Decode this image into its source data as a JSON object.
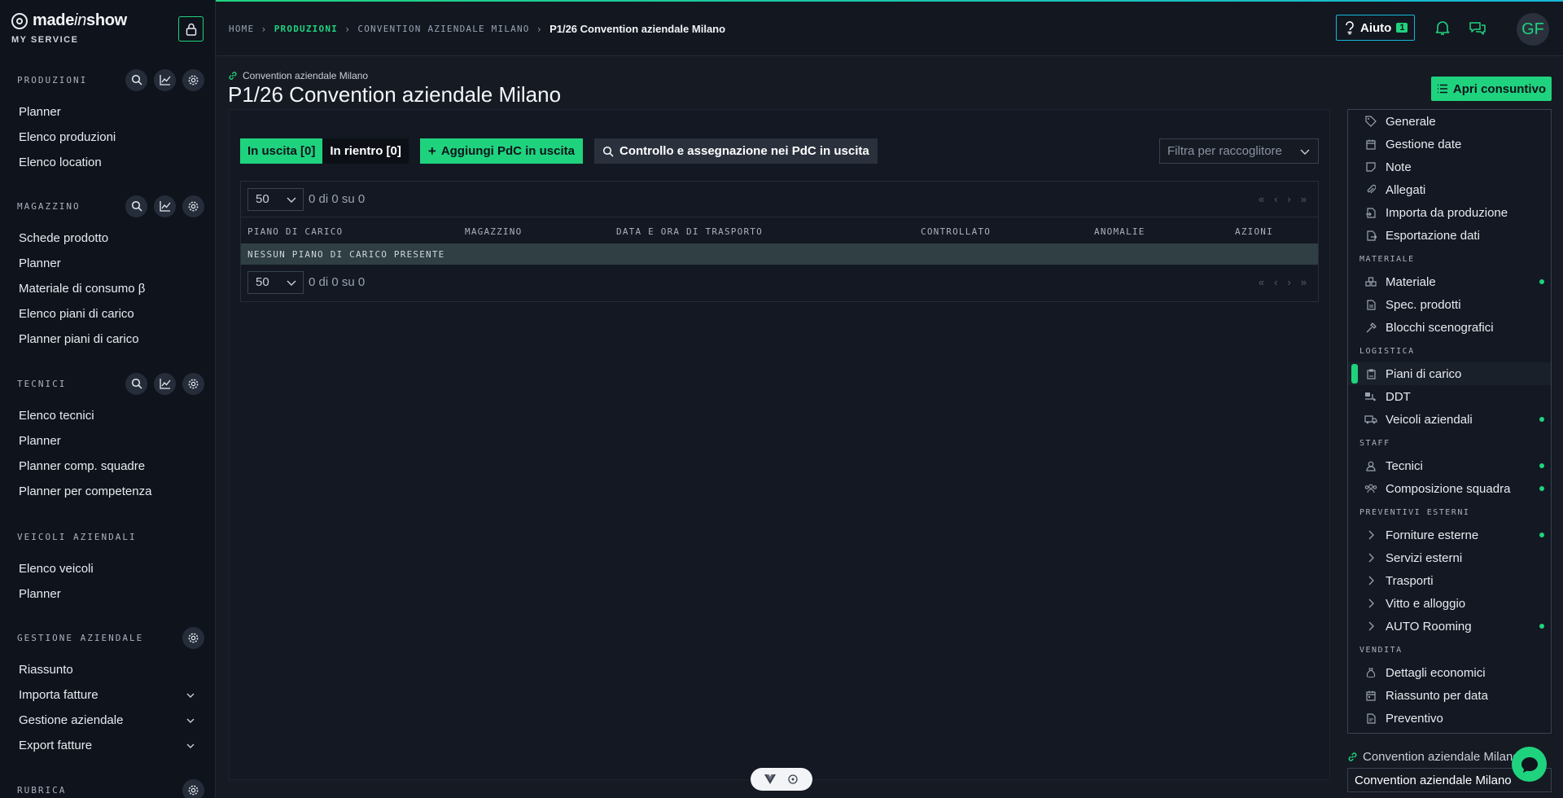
{
  "brand": {
    "name_bold": "made",
    "name_italic": "in",
    "name_end": "show",
    "subtitle": "MY SERVICE"
  },
  "sidebar": {
    "sections": [
      {
        "title": "PRODUZIONI",
        "items": [
          "Planner",
          "Elenco produzioni",
          "Elenco location"
        ]
      },
      {
        "title": "MAGAZZINO",
        "items": [
          "Schede prodotto",
          "Planner",
          "Materiale di consumo β",
          "Elenco piani di carico",
          "Planner piani di carico"
        ]
      },
      {
        "title": "TECNICI",
        "items": [
          "Elenco tecnici",
          "Planner",
          "Planner comp. squadre",
          "Planner per competenza"
        ]
      },
      {
        "title": "VEICOLI AZIENDALI",
        "items": [
          "Elenco veicoli",
          "Planner"
        ]
      },
      {
        "title": "GESTIONE AZIENDALE",
        "items": [
          "Riassunto",
          "Importa fatture",
          "Gestione aziendale",
          "Export fatture"
        ]
      },
      {
        "title": "RUBRICA",
        "items": []
      }
    ]
  },
  "header": {
    "breadcrumb": [
      "HOME",
      "PRODUZIONI",
      "CONVENTION AZIENDALE MILANO",
      "P1/26 Convention aziendale Milano"
    ],
    "help_label": "Aiuto",
    "help_badge": "1",
    "avatar_initials": "GF"
  },
  "page": {
    "parent_link": "Convention aziendale Milano",
    "title": "P1/26 Convention aziendale Milano",
    "consuntivo_label": "Apri consuntivo"
  },
  "toolbar": {
    "tab_out": "In uscita [0]",
    "tab_in": "In rientro [0]",
    "add_label": "Aggiungi PdC in uscita",
    "control_label": "Controllo e assegnazione nei PdC in uscita",
    "filter_placeholder": "Filtra per raccoglitore"
  },
  "table": {
    "page_size": "50",
    "pager_info": "0 di 0 su 0",
    "columns": [
      "PIANO DI CARICO",
      "MAGAZZINO",
      "DATA E ORA DI TRASPORTO",
      "CONTROLLATO",
      "ANOMALIE",
      "AZIONI"
    ],
    "empty_message": "NESSUN PIANO DI CARICO PRESENTE"
  },
  "right_panel": {
    "groups": [
      {
        "category": "",
        "items": [
          {
            "label": "Generale",
            "icon": "tag-icon",
            "dot": false
          },
          {
            "label": "Gestione date",
            "icon": "calendar-icon",
            "dot": false
          },
          {
            "label": "Note",
            "icon": "note-icon",
            "dot": false
          },
          {
            "label": "Allegati",
            "icon": "paperclip-icon",
            "dot": false
          },
          {
            "label": "Importa da produzione",
            "icon": "import-icon",
            "dot": false
          },
          {
            "label": "Esportazione dati",
            "icon": "export-icon",
            "dot": false
          }
        ]
      },
      {
        "category": "MATERIALE",
        "items": [
          {
            "label": "Materiale",
            "icon": "boxes-icon",
            "dot": true
          },
          {
            "label": "Spec. prodotti",
            "icon": "file-icon",
            "dot": false
          },
          {
            "label": "Blocchi scenografici",
            "icon": "hammer-icon",
            "dot": false
          }
        ]
      },
      {
        "category": "LOGISTICA",
        "items": [
          {
            "label": "Piani di carico",
            "icon": "clipboard-icon",
            "dot": false,
            "selected": true
          },
          {
            "label": "DDT",
            "icon": "truck-loading-icon",
            "dot": false
          },
          {
            "label": "Veicoli aziendali",
            "icon": "truck-icon",
            "dot": true
          }
        ]
      },
      {
        "category": "STAFF",
        "items": [
          {
            "label": "Tecnici",
            "icon": "user-icon",
            "dot": true
          },
          {
            "label": "Composizione squadra",
            "icon": "users-icon",
            "dot": true
          }
        ]
      },
      {
        "category": "PREVENTIVI ESTERNI",
        "items": [
          {
            "label": "Forniture esterne",
            "icon": "chevron-right-icon",
            "dot": true
          },
          {
            "label": "Servizi esterni",
            "icon": "chevron-right-icon",
            "dot": false
          },
          {
            "label": "Trasporti",
            "icon": "chevron-right-icon",
            "dot": false
          },
          {
            "label": "Vitto e alloggio",
            "icon": "chevron-right-icon",
            "dot": false
          },
          {
            "label": "AUTO Rooming",
            "icon": "chevron-right-icon",
            "dot": true
          }
        ]
      },
      {
        "category": "VENDITA",
        "items": [
          {
            "label": "Dettagli economici",
            "icon": "moneybag-icon",
            "dot": false
          },
          {
            "label": "Riassunto per data",
            "icon": "calendar-check-icon",
            "dot": false
          },
          {
            "label": "Preventivo",
            "icon": "document-icon",
            "dot": false
          }
        ]
      }
    ]
  },
  "footer": {
    "link_label": "Convention aziendale Milano",
    "field_value": "Convention aziendale Milano"
  },
  "colors": {
    "accent": "#1fd37e",
    "cyan": "#16b8d8",
    "background": "#151a23"
  }
}
